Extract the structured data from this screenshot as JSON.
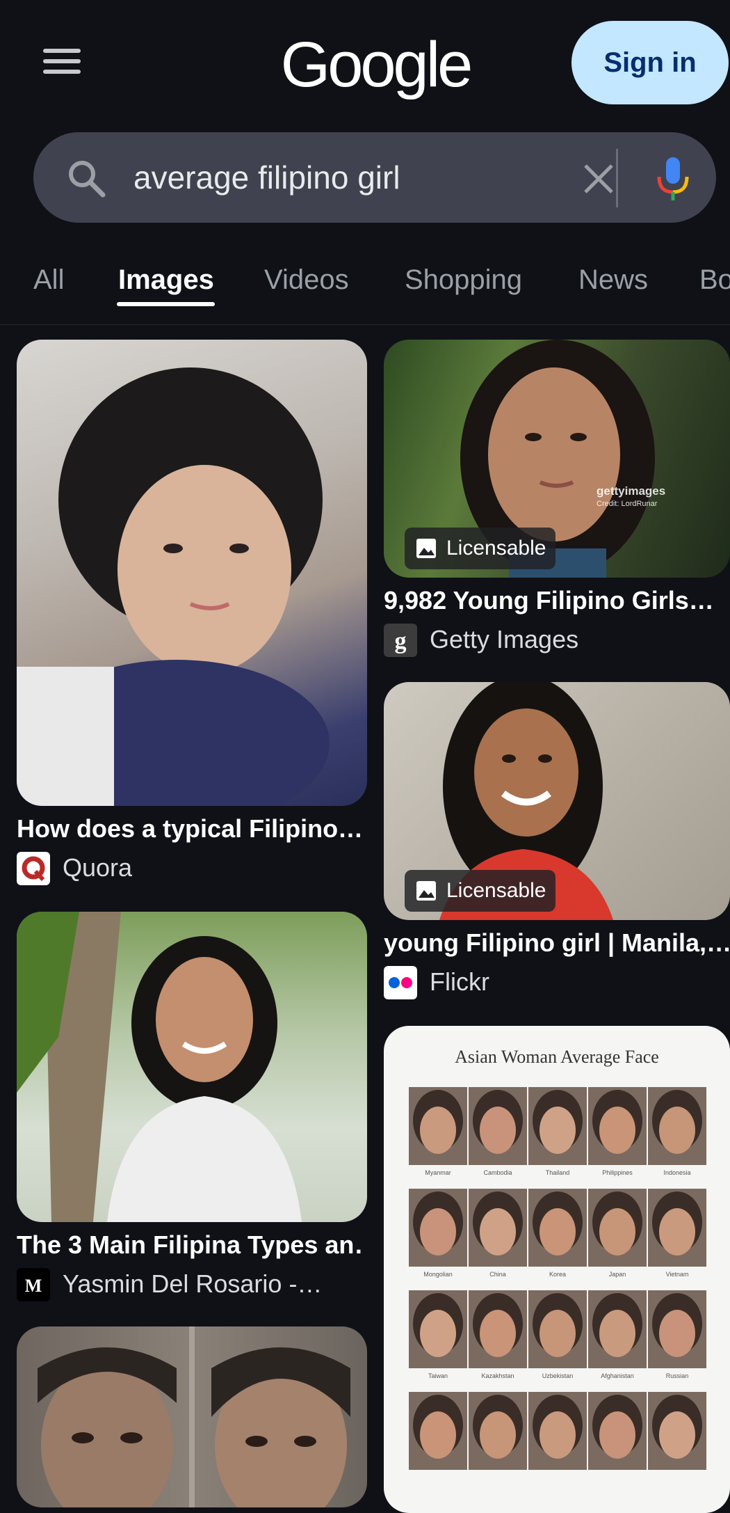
{
  "header": {
    "logo": "Google",
    "sign_in": "Sign in"
  },
  "search": {
    "query": "average filipino girl",
    "icons": [
      "search-icon",
      "clear-icon",
      "microphone-icon"
    ]
  },
  "tabs": [
    {
      "label": "All",
      "active": false
    },
    {
      "label": "Images",
      "active": true
    },
    {
      "label": "Videos",
      "active": false
    },
    {
      "label": "Shopping",
      "active": false
    },
    {
      "label": "News",
      "active": false
    },
    {
      "label": "Bo",
      "active": false
    }
  ],
  "results": [
    {
      "title": "How does a typical Filipino…",
      "source": "Quora",
      "badge": ""
    },
    {
      "title": "9,982 Young Filipino Girls…",
      "source": "Getty Images",
      "badge": "Licensable",
      "watermark": "gettyimages",
      "watermark_sub": "Credit: LordRunar"
    },
    {
      "title": "young Filipino girl | Manila,…",
      "source": "Flickr",
      "badge": "Licensable"
    },
    {
      "title": "The 3 Main Filipina Types an…",
      "source": "Yasmin Del Rosario -…",
      "badge": ""
    },
    {
      "title": "",
      "source": "",
      "badge": ""
    },
    {
      "title": "",
      "source": "",
      "badge": "",
      "poster_title": "Asian Woman Average Face",
      "poster_labels": [
        [
          "Myanmar",
          "Cambodia",
          "Thailand",
          "Philippines",
          "Indonesia"
        ],
        [
          "Mongolian",
          "China",
          "Korea",
          "Japan",
          "Vietnam"
        ],
        [
          "Taiwan",
          "Kazakhstan",
          "Uzbekistan",
          "Afghanistan",
          "Russian"
        ]
      ]
    }
  ],
  "colors": {
    "background": "#0f1117",
    "search_bg": "#40434f",
    "signin_bg": "#c2e7ff",
    "signin_text": "#062e6f"
  }
}
